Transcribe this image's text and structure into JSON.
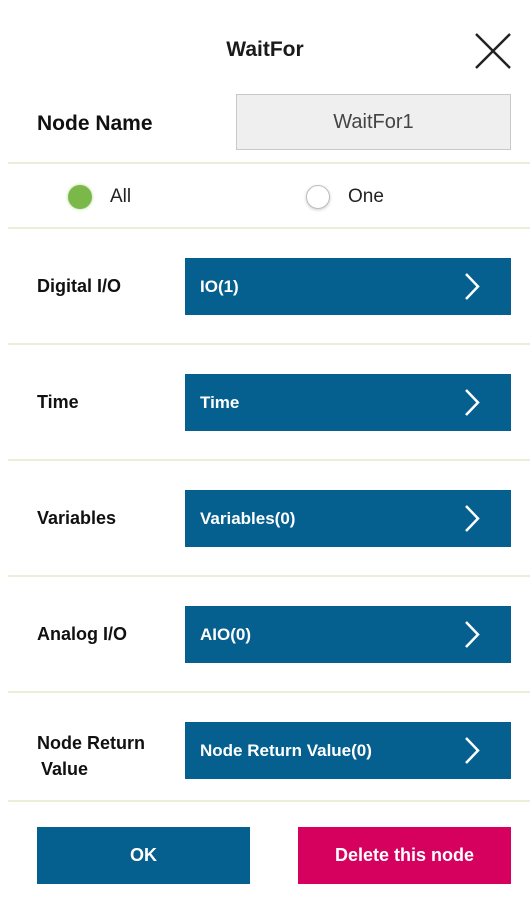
{
  "dialog": {
    "title": "WaitFor"
  },
  "node_name": {
    "label": "Node Name",
    "value": "WaitFor1"
  },
  "mode": {
    "options": [
      "All",
      "One"
    ],
    "selected": "All",
    "selected_color": "#7ab84a"
  },
  "fields": [
    {
      "label": "Digital I/O",
      "button": "IO(1)"
    },
    {
      "label": "Time",
      "button": "Time"
    },
    {
      "label": "Variables",
      "button": "Variables(0)"
    },
    {
      "label": "Analog I/O",
      "button": "AIO(0)"
    },
    {
      "label_line1": "Node Return",
      "label_line2": "Value",
      "button": "Node Return Value(0)"
    }
  ],
  "footer": {
    "ok_label": "OK",
    "delete_label": "Delete this node"
  },
  "colors": {
    "primary": "#05608f",
    "danger": "#d6005e",
    "divider": "#ecefd8"
  }
}
